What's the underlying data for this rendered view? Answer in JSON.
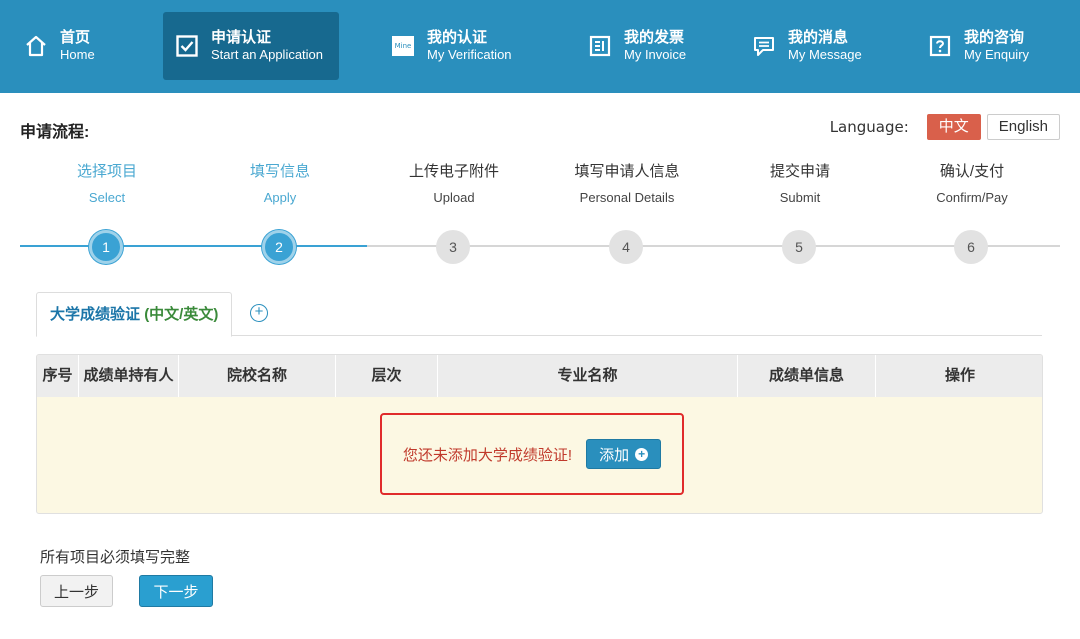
{
  "nav": [
    {
      "zh": "首页",
      "en": "Home",
      "icon": "home-icon",
      "active": false
    },
    {
      "zh": "申请认证",
      "en": "Start an Application",
      "icon": "checkbox-icon",
      "active": true
    },
    {
      "zh": "我的认证",
      "en": "My Verification",
      "icon": "mine-icon",
      "active": false
    },
    {
      "zh": "我的发票",
      "en": "My Invoice",
      "icon": "invoice-icon",
      "active": false
    },
    {
      "zh": "我的消息",
      "en": "My Message",
      "icon": "message-icon",
      "active": false
    },
    {
      "zh": "我的咨询",
      "en": "My Enquiry",
      "icon": "enquiry-icon",
      "active": false
    }
  ],
  "mine_icon_text": "Mine",
  "process_title": "申请流程:",
  "language": {
    "label": "Language:",
    "options": [
      "中文",
      "English"
    ],
    "selected": "中文"
  },
  "steps": [
    {
      "zh": "选择项目",
      "en": "Select",
      "num": "1",
      "done": true
    },
    {
      "zh": "填写信息",
      "en": "Apply",
      "num": "2",
      "done": true
    },
    {
      "zh": "上传电子附件",
      "en": "Upload",
      "num": "3",
      "done": false
    },
    {
      "zh": "填写申请人信息",
      "en": "Personal Details",
      "num": "4",
      "done": false
    },
    {
      "zh": "提交申请",
      "en": "Submit",
      "num": "5",
      "done": false
    },
    {
      "zh": "确认/支付",
      "en": "Confirm/Pay",
      "num": "6",
      "done": false
    }
  ],
  "tab": {
    "label": "大学成绩验证",
    "suffix": "(中文/英文)",
    "add_symbol": "+"
  },
  "table": {
    "headers": [
      "序号",
      "成绩单持有人",
      "院校名称",
      "层次",
      "专业名称",
      "成绩单信息",
      "操作"
    ],
    "empty_message": "您还未添加大学成绩验证!",
    "add_button": "添加",
    "add_symbol": "+"
  },
  "footer": {
    "note": "所有项目必须填写完整",
    "prev": "上一步",
    "next": "下一步"
  },
  "colors": {
    "nav_bg": "#2a8fbd",
    "nav_active": "#17698f",
    "lang_active": "#d9604b",
    "step_done": "#3aa2d4",
    "empty_bg": "#fcf8e3",
    "highlight": "#e02b2b"
  }
}
